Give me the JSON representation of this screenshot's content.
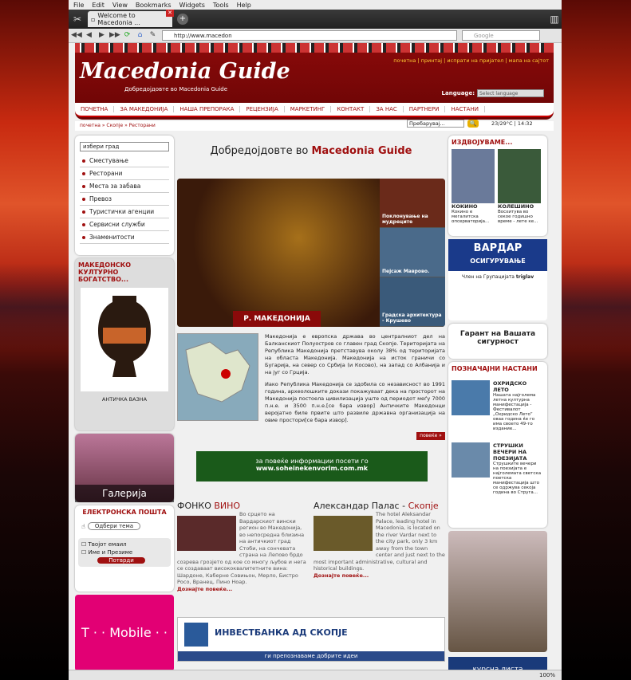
{
  "browser": {
    "menu": [
      "File",
      "Edit",
      "View",
      "Bookmarks",
      "Widgets",
      "Tools",
      "Help"
    ],
    "tab_title": "Welcome to Macedonia ...",
    "url": "http://www.macedon",
    "search_placeholder": "Google",
    "zoom": "100%"
  },
  "header": {
    "logo": "Macedonia Guide",
    "subtitle": "Добредојдовте во Macedonia Guide",
    "top_links": "почетна | принтај | испрати на пријател | мапа на сајтот",
    "language_label": "Language:",
    "language_select": "Select language"
  },
  "nav": [
    "ПОЧЕТНА",
    "ЗА МАКЕДОНИЈА",
    "НАША ПРЕПОРАКА",
    "РЕЦЕНЗИЈА",
    "МАРКЕТИНГ",
    "КОНТАКТ",
    "ЗА НАС",
    "ПАРТНЕРИ",
    "НАСТАНИ"
  ],
  "breadcrumb": "почетна » Скопје » Ресторани",
  "search_box": "Пребарувај...",
  "weather": "23/29°C | 14:32",
  "left": {
    "city_select": "избери град",
    "menu": [
      "Сместување",
      "Ресторани",
      "Места за забава",
      "Превоз",
      "Туристички агенции",
      "Сервисни служби",
      "Знаменитости"
    ],
    "culture_title": "МАКЕДОНСКО КУЛТУРНО БОГАТСТВО...",
    "vase_caption": "АНТИЧКА ВАЗНА",
    "gallery_label": "Галерија",
    "email_title": "ЕЛЕКТРОНСКА ПОШТА",
    "topic_select": "Одбери тема",
    "email_field": "Твојот емаил",
    "name_field": "Име и Презиме",
    "confirm_button": "Потврди",
    "tmobile": "T · · Mobile · ·"
  },
  "center": {
    "welcome_prefix": "Добредојдовте во",
    "welcome_brand": "Macedonia Guide",
    "hero_caption": "Р. МАКЕДОНИЈА",
    "thumbs": [
      "Поклонување на мудреците",
      "Пејсаж Маврово.",
      "Градска архитектура - Крушево"
    ],
    "desc_1": "Македонија е европска држава во централниот дел на Балканскиот Полуостров со главен град Скопје. Територијата на Република Македонија претставува околу 38% од територијата на областа Македонија. Македонија на исток граничи со Бугарија, на север со Србија (и Косово), на запад со Албанија и на југ со Грција.",
    "desc_2": "Иако Република Македонија се здобила со независност во 1991 година, археолошките докази покажуваат дека на просторот на Македонија постоела цивилизација уште од периодот меѓу 7000 п.н.е. и 3500 п.н.е.[се бара извор] Античките Македонци веројатно биле првите што развиле државна организација на овие простори[се бара извор].",
    "more": "повеќе »",
    "banner_line1": "за повеќе информации посети го",
    "banner_line2": "www.soheinekenvorim.com.mk",
    "art1_title_a": "ФОНКО",
    "art1_title_b": "ВИНО",
    "art1_text": "Во срцето на Вардарскиот вински регион во Македонија, во непосредна близина на античкиот град Стоби, на сончевата страна на Лепово брдо созрева грозјето од кое со многу љубов и нега се создаваат висококвалитетните вина: Шардоне, Каберне Совињон, Мерло, Бистро Росо, Вранец, Пино Ноар.",
    "art1_link": "Дознајте повеќе...",
    "art2_title_a": "Александар Палас -",
    "art2_title_b": "Скопје",
    "art2_text": "The hotel Aleksandar Palace, leading hotel in Macedonia, is located on the river Vardar next to the city park, only 3 km away from the town center and just next to the most important administrative, cultural and historical buildings.",
    "art2_link": "Дознајте повеќе...",
    "invest_title": "ИНВЕСТБАНКА АД СКОПЈЕ",
    "invest_slogan": "ги препознаваме добрите идеи"
  },
  "right": {
    "standout_title": "ИЗДВОЈУВАМЕ...",
    "kokino_title": "КОКИНО",
    "kokino_text": "Кокино е мегалитска опсерваторија...",
    "kolesino_title": "КОЛЕШИНО",
    "kolesino_text": "Восхитува во секое годишно време - лете ке...",
    "vardar_title": "ВАРДАР",
    "vardar_sub": "ОСИГУРУВАЊЕ",
    "vardar_member": "Член на Групацијата",
    "vardar_brand": "triglav",
    "garant": "Гарант на Вашата сигурност",
    "events_title": "ПОЗНАЧАЈНИ НАСТАНИ",
    "event1_title": "ОХРИДСКО ЛЕТО",
    "event1_text": "Нашата најголема летна културна манифестација - Фестивалот „Охридско Лето“ оваа година ќе го има своето 49-то издание...",
    "event2_title": "СТРУШКИ ВЕЧЕРИ НА ПОЕЗИЈАТА",
    "event2_text": "Струшките вечери на поезијата е најголемата светска поетска манифестација што се одржува секоја година во Струга...",
    "kurs": "курсна листа"
  }
}
